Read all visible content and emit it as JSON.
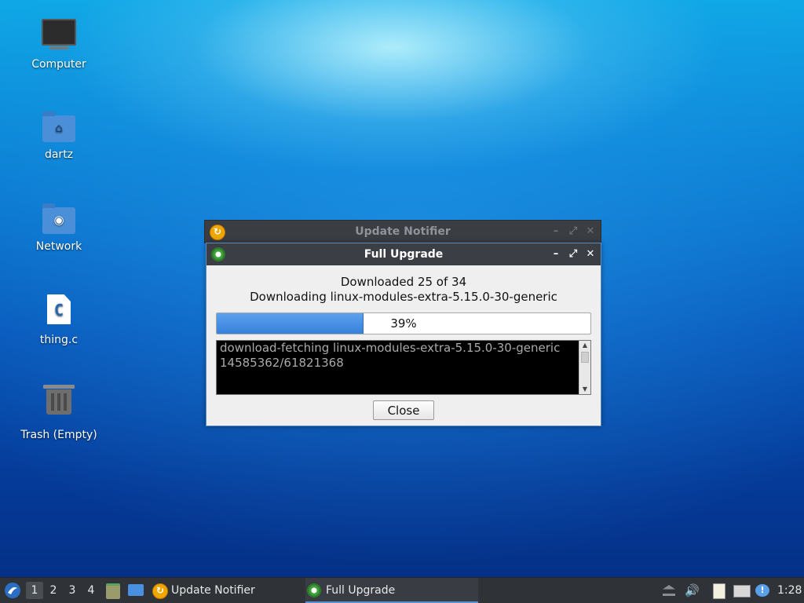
{
  "desktop": {
    "icons": [
      {
        "label": "Computer",
        "icon": "computer-icon"
      },
      {
        "label": "dartz",
        "icon": "home-folder-icon"
      },
      {
        "label": "Network",
        "icon": "network-folder-icon"
      },
      {
        "label": "thing.c",
        "icon": "c-source-file-icon",
        "glyph": "C"
      },
      {
        "label": "Trash (Empty)",
        "icon": "trash-icon"
      }
    ]
  },
  "background_window": {
    "title": "Update Notifier",
    "icon": "update-notifier-icon",
    "controls": {
      "minimize": "–",
      "maximize": "⤢",
      "close": "✕"
    }
  },
  "dialog": {
    "title": "Full Upgrade",
    "icon": "gear-icon",
    "controls": {
      "minimize": "–",
      "maximize": "⤢",
      "close": "✕"
    },
    "status_line1": "Downloaded 25 of 34",
    "status_line2": "Downloading linux-modules-extra-5.15.0-30-generic",
    "progress": {
      "value": 39,
      "label": "39%"
    },
    "log_text": "download-fetching linux-modules-extra-5.15.0-30-generic\n14585362/61821368",
    "close_label": "Close"
  },
  "taskbar": {
    "workspaces": [
      "1",
      "2",
      "3",
      "4"
    ],
    "active_workspace": "1",
    "tasks": [
      {
        "label": "Update Notifier",
        "icon": "update-notifier-icon",
        "active": false
      },
      {
        "label": "Full Upgrade",
        "icon": "gear-icon",
        "active": true
      }
    ],
    "tray_icons": [
      "eject-icon",
      "volume-icon",
      "clipboard-icon",
      "network-icon",
      "notification-icon"
    ],
    "clock": "1:28"
  },
  "colors": {
    "accent": "#3680db",
    "titlebar": "#3b3f45",
    "taskbar": "#2f3338"
  }
}
